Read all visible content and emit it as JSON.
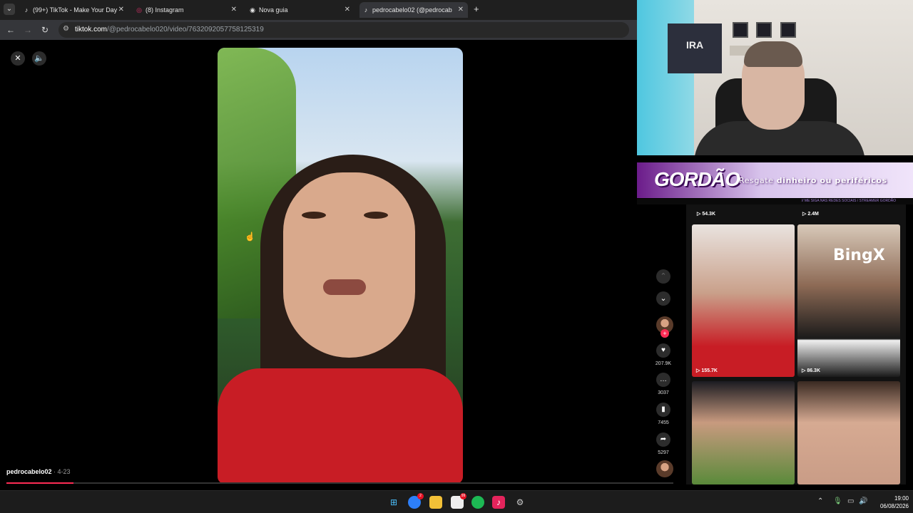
{
  "browser": {
    "tabs": [
      {
        "title": "(99+) TikTok - Make Your Day",
        "icon": "tiktok-icon",
        "close": "✕"
      },
      {
        "title": "(8) Instagram",
        "icon": "instagram-icon",
        "close": "✕"
      },
      {
        "title": "Nova guia",
        "icon": "chrome-icon",
        "close": "✕"
      },
      {
        "title": "pedrocabelo02 (@pedrocab",
        "icon": "tiktok-icon",
        "close": "✕",
        "active": true
      }
    ],
    "new_tab": "+",
    "url_host": "tiktok.com",
    "url_path": "/@pedrocabelo020/video/7632092057758125319"
  },
  "video": {
    "author": "pedrocabelo02",
    "date": " · 4-23",
    "progress": 0.1,
    "actions": {
      "likes": "207.9K",
      "comments": "3037",
      "saves": "7455",
      "shares": "5297"
    }
  },
  "overlay": {
    "banner_logo": "GORDÃO",
    "banner_text_1": "Resgate ",
    "banner_text_2": "dinheiro ou periféricos",
    "banner_sub": "// ME SIGA NAS REDES SOCIAIS / STREAMER GORDÃO",
    "poster_text": "IRA",
    "sponsor": "BingX"
  },
  "grid": {
    "top_stats": [
      "54.3K",
      "2.4M"
    ],
    "thumbs": [
      {
        "views": "155.7K"
      },
      {
        "views": "86.3K"
      },
      {
        "views": ""
      },
      {
        "views": ""
      }
    ]
  },
  "taskbar": {
    "time": "19:00",
    "date": "06/08/2026",
    "badge_files": "99",
    "badge_mail": "2"
  },
  "colors": {
    "accent": "#fe2c55",
    "banner_purple": "#6b1c8a",
    "shirt_red": "#c81d25"
  }
}
